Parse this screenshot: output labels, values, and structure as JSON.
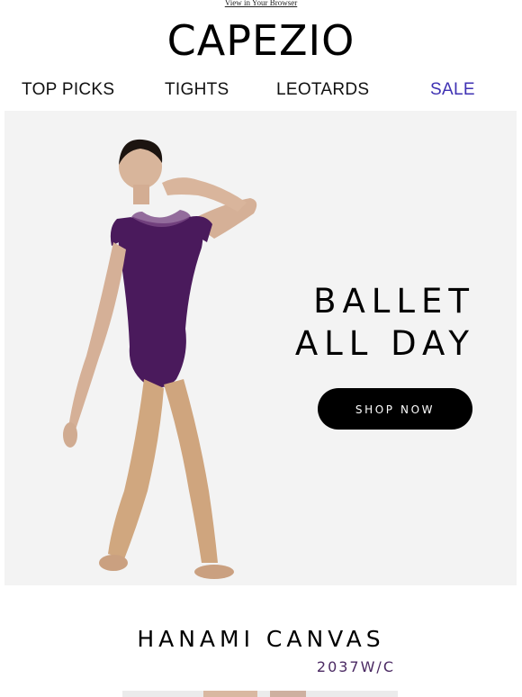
{
  "header": {
    "browser_link": "View in Your Browser",
    "logo": "CAPEZIO"
  },
  "nav": {
    "items": [
      {
        "label": "TOP PICKS"
      },
      {
        "label": "TIGHTS"
      },
      {
        "label": "LEOTARDS"
      },
      {
        "label": "SALE"
      }
    ]
  },
  "hero": {
    "headline_line1": "BALLET",
    "headline_line2": "ALL DAY",
    "cta_label": "SHOP NOW",
    "background_color": "#f3f3f3",
    "leotard_color": "#4a1a5c"
  },
  "product": {
    "name": "HANAMI CANVAS",
    "sku": "2037W/C",
    "sku_color": "#4b2a63"
  },
  "colors": {
    "sale": "#3f32b3",
    "cta_background": "#000000",
    "cta_text": "#ffffff"
  }
}
